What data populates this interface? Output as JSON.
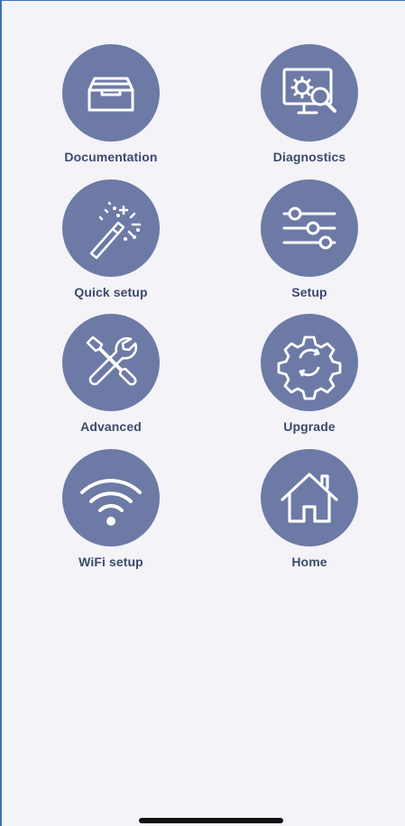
{
  "menu": {
    "items": [
      {
        "label": "Documentation",
        "icon": "inbox-tray-icon"
      },
      {
        "label": "Diagnostics",
        "icon": "monitor-gear-search-icon"
      },
      {
        "label": "Quick setup",
        "icon": "magic-wand-icon"
      },
      {
        "label": "Setup",
        "icon": "sliders-icon"
      },
      {
        "label": "Advanced",
        "icon": "wrench-screwdriver-icon"
      },
      {
        "label": "Upgrade",
        "icon": "gear-icon"
      },
      {
        "label": "WiFi setup",
        "icon": "wifi-icon"
      },
      {
        "label": "Home",
        "icon": "house-icon"
      }
    ]
  },
  "colors": {
    "background": "#f3f3f8",
    "circle": "#6d7aa6",
    "label": "#3d4a6e",
    "icon": "#ffffff",
    "frame_border": "#3f6fb5",
    "home_indicator": "#111111"
  }
}
